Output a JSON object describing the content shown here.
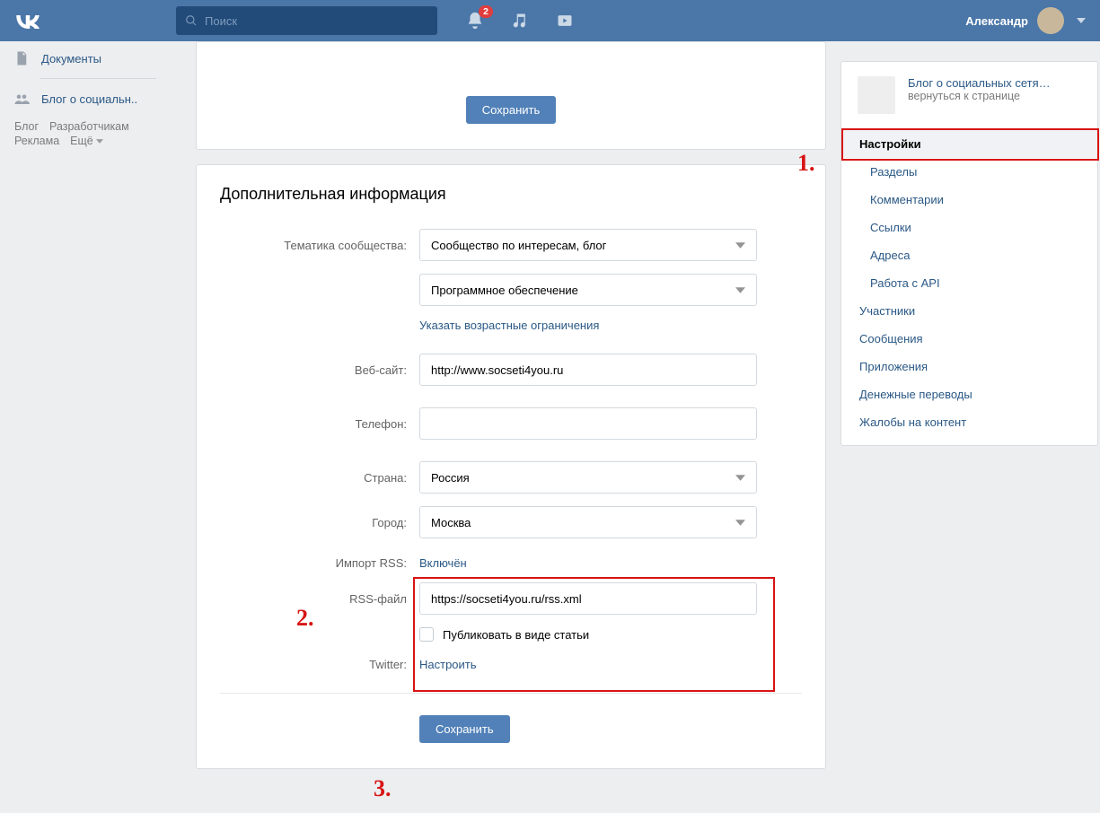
{
  "header": {
    "search_placeholder": "Поиск",
    "notif_count": "2",
    "user_name": "Александр"
  },
  "leftnav": {
    "documents": "Документы",
    "blog_group": "Блог о социальн..",
    "footer": {
      "blog": "Блог",
      "developers": "Разработчикам",
      "ads": "Реклама",
      "more": "Ещё"
    }
  },
  "topcard": {
    "save": "Сохранить"
  },
  "main": {
    "title": "Дополнительная информация",
    "rows": {
      "topic_label": "Тематика сообщества:",
      "topic_sel1": "Сообщество по интересам, блог",
      "topic_sel2": "Программное обеспечение",
      "age_link": "Указать возрастные ограничения",
      "website_label": "Веб-сайт:",
      "website_val": "http://www.socseti4you.ru",
      "phone_label": "Телефон:",
      "phone_val": "",
      "country_label": "Страна:",
      "country_sel": "Россия",
      "city_label": "Город:",
      "city_sel": "Москва",
      "rss_import_label": "Импорт RSS:",
      "rss_import_val": "Включён",
      "rss_file_label": "RSS-файл",
      "rss_file_val": "https://socseti4you.ru/rss.xml",
      "rss_checkbox": "Публиковать в виде статьи",
      "twitter_label": "Twitter:",
      "twitter_link": "Настроить"
    },
    "save": "Сохранить"
  },
  "right": {
    "group_title": "Блог о социальных сетя…",
    "group_sub": "вернуться к странице",
    "menu": {
      "settings": "Настройки",
      "sections": "Разделы",
      "comments": "Комментарии",
      "links": "Ссылки",
      "addresses": "Адреса",
      "api": "Работа с API",
      "members": "Участники",
      "messages": "Сообщения",
      "apps": "Приложения",
      "payments": "Денежные переводы",
      "reports": "Жалобы на контент"
    }
  },
  "anno": {
    "n1": "1.",
    "n2": "2.",
    "n3": "3."
  }
}
